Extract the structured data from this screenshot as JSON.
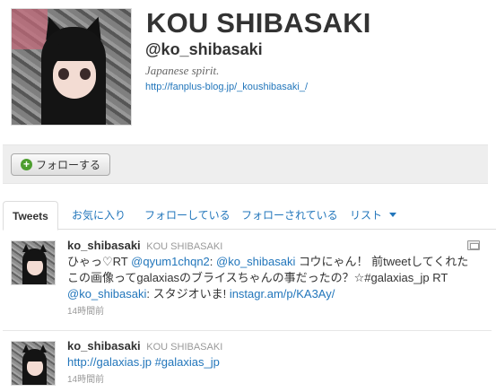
{
  "profile": {
    "display_name": "KOU SHIBASAKI",
    "screen_name": "@ko_shibasaki",
    "bio": "Japanese spirit.",
    "url": "http://fanplus-blog.jp/_koushibasaki_/"
  },
  "actions": {
    "follow_label": "フォローする",
    "follow_icon": "+"
  },
  "tabs": [
    {
      "label": "Tweets",
      "active": true
    },
    {
      "label": "お気に入り"
    },
    {
      "label": "フォローしている"
    },
    {
      "label": "フォローされている"
    },
    {
      "label": "リスト"
    }
  ],
  "tweets": [
    {
      "user": "ko_shibasaki",
      "fullname": "KOU SHIBASAKI",
      "parts": [
        {
          "t": "ひゃっ♡RT "
        },
        {
          "t": "@qyum1chqn2",
          "link": true
        },
        {
          "t": ": "
        },
        {
          "t": "@ko_shibasaki",
          "link": true
        },
        {
          "t": " コウにゃん！ 前tweetしてくれたこの画像ってgalaxiasのブライスちゃんの事だったの？☆#galaxias_jp RT "
        },
        {
          "t": "@ko_shibasaki",
          "link": true
        },
        {
          "t": ": スタジオいま! "
        },
        {
          "t": "instagr.am/p/KA3Ay/",
          "link": true
        }
      ],
      "time": "14時間前"
    },
    {
      "user": "ko_shibasaki",
      "fullname": "KOU SHIBASAKI",
      "parts": [
        {
          "t": "http://galaxias.jp",
          "link": true
        },
        {
          "t": " "
        },
        {
          "t": "#galaxias_jp",
          "link": true
        }
      ],
      "time": "14時間前"
    }
  ],
  "colors": {
    "link": "#2276bb",
    "follow_plus": "#4d9e2f",
    "action_bar": "#eeeeee"
  }
}
